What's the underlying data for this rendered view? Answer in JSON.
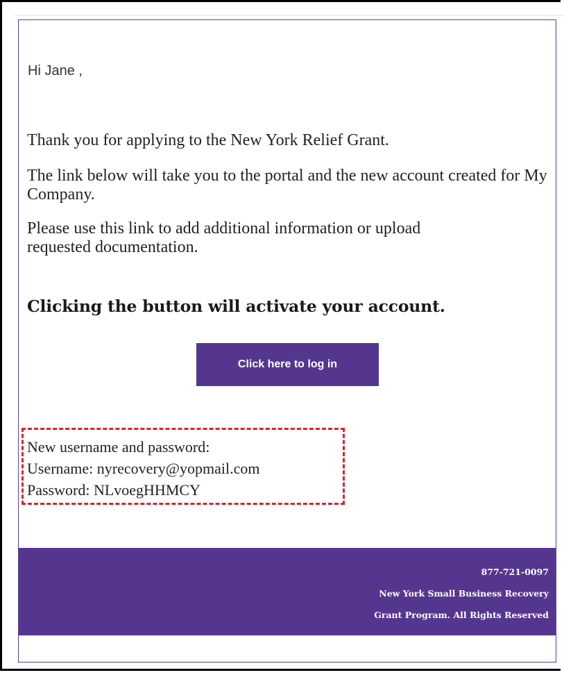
{
  "email": {
    "greeting": "Hi Jane ,",
    "paragraphs": [
      "Thank you for applying to the New York Relief Grant.",
      "The link below will take you to the portal and the new account created for My Company.",
      "Please use this link to add additional information or upload requested documentation."
    ],
    "headline": "Clicking the button will activate your account.",
    "login_button_label": "Click here to log in",
    "credentials": {
      "heading": "New username and password:",
      "username_line": "Username: nyrecovery@yopmail.com",
      "password_line": "Password: NLvoegHHMCY"
    },
    "footer": {
      "phone": "877-721-0097",
      "org_line_1": "New York Small Business Recovery",
      "org_line_2": "Grant Program. All Rights Reserved"
    }
  },
  "colors": {
    "brand_purple": "#55368f",
    "highlight_red": "#e0202a",
    "card_border": "#5b3d94"
  }
}
